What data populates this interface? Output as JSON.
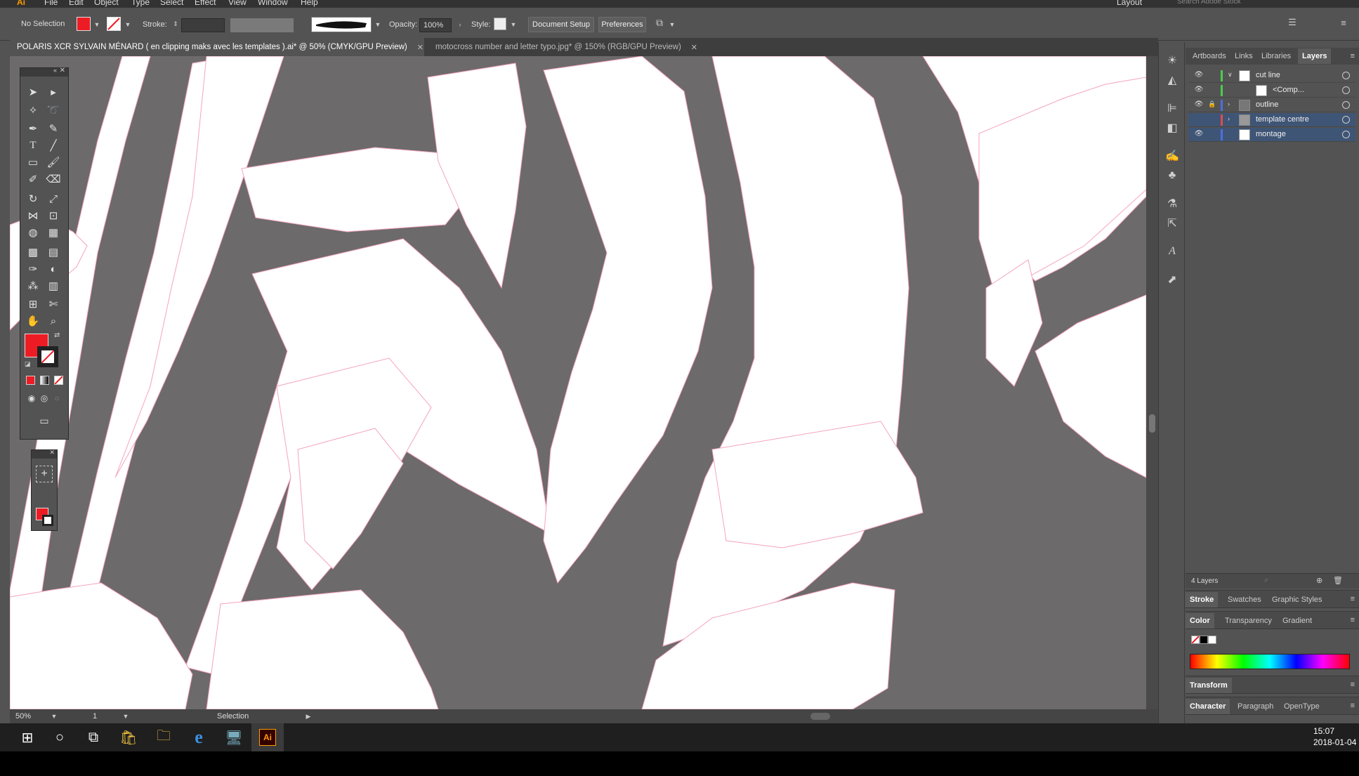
{
  "app": {
    "logo": "Ai"
  },
  "menu": [
    "File",
    "Edit",
    "Object",
    "Type",
    "Select",
    "Effect",
    "View",
    "Window",
    "Help"
  ],
  "workspace": {
    "label": "Layout",
    "search_placeholder": "Search Adobe Stock"
  },
  "control_bar": {
    "selection": "No Selection",
    "stroke_label": "Stroke:",
    "opacity_label": "Opacity:",
    "opacity_value": "100%",
    "style_label": "Style:",
    "document_setup": "Document Setup",
    "preferences": "Preferences",
    "fill_color": "#ed1c24"
  },
  "tabs": [
    {
      "label": "POLARIS XCR SYLVAIN MÉNARD ( en clipping maks avec les templates ).ai* @ 50% (CMYK/GPU Preview)",
      "active": true
    },
    {
      "label": "motocross number and letter typo.jpg* @ 150% (RGB/GPU Preview)",
      "active": false
    }
  ],
  "status_bar": {
    "zoom": "50%",
    "artboard": "1",
    "mode": "Selection"
  },
  "panels": {
    "top_tabs": [
      "Artboards",
      "Links",
      "Libraries",
      "Layers"
    ],
    "active_top_tab": "Layers",
    "layers": [
      {
        "name": "cut line",
        "expanded": true,
        "color": "#4ccc4c",
        "visible": true,
        "locked": false,
        "selected": false
      },
      {
        "name": "<Comp...",
        "sublayer": true,
        "color": "#4ccc4c",
        "visible": true,
        "locked": false,
        "selected": false
      },
      {
        "name": "outline",
        "expanded": false,
        "color": "#4c6fe0",
        "visible": true,
        "locked": true,
        "selected": false
      },
      {
        "name": "template centre",
        "expanded": false,
        "color": "#e04c4c",
        "visible": false,
        "locked": false,
        "selected": true
      },
      {
        "name": "montage",
        "expanded": false,
        "color": "#4c6fe0",
        "visible": true,
        "locked": false,
        "selected": true
      }
    ],
    "layer_count": "4 Layers",
    "stroke_group": [
      "Stroke",
      "Swatches",
      "Graphic Styles"
    ],
    "color_group": [
      "Color",
      "Transparency",
      "Gradient"
    ],
    "transform": "Transform",
    "char_group": [
      "Character",
      "Paragraph",
      "OpenType"
    ]
  },
  "taskbar": {
    "time": "15:07",
    "date": "2018-01-04"
  }
}
